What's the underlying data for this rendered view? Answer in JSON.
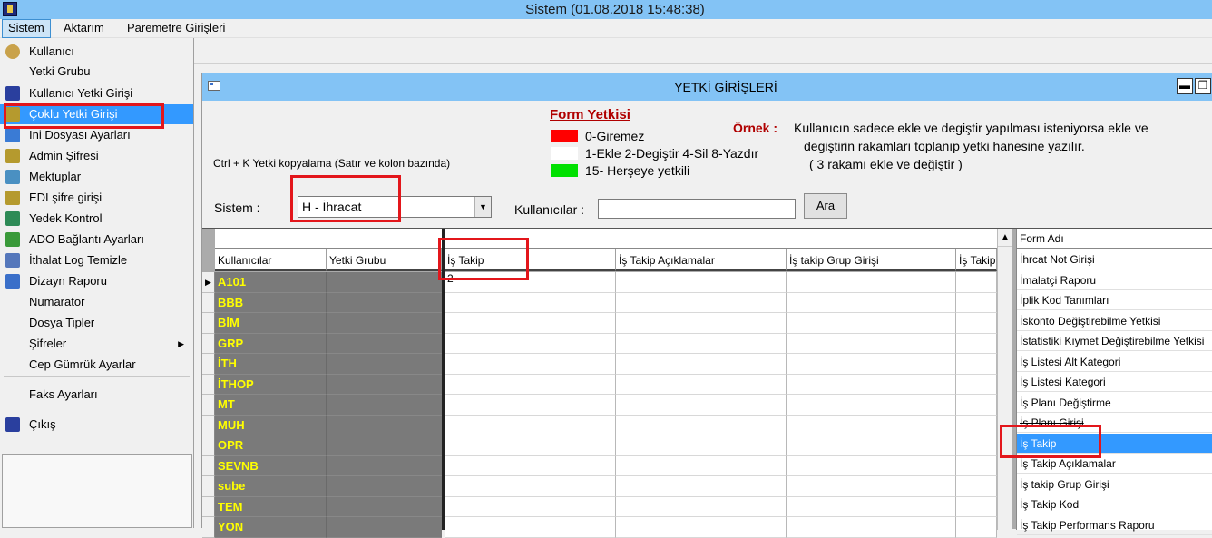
{
  "app": {
    "title": "Sistem (01.08.2018 15:48:38)"
  },
  "menubar": {
    "items": [
      "Sistem",
      "Aktarım",
      "Paremetre Girişleri"
    ]
  },
  "sistem_menu": {
    "items": [
      {
        "label": "Kullanıcı",
        "icon": "user-icon"
      },
      {
        "label": "Yetki Grubu",
        "icon": ""
      },
      {
        "label": "Kullanıcı Yetki Girişi",
        "icon": "book-icon"
      },
      {
        "label": "Çoklu Yetki Girişi",
        "icon": "key-icon",
        "selected": true
      },
      {
        "label": "Ini Dosyası Ayarları",
        "icon": "settings-file-icon"
      },
      {
        "label": "Admin Şifresi",
        "icon": "key-icon"
      },
      {
        "label": "Mektuplar",
        "icon": "mail-icon"
      },
      {
        "label": "EDI şifre girişi",
        "icon": "key-icon"
      },
      {
        "label": "Yedek Kontrol",
        "icon": "backup-icon"
      },
      {
        "label": "ADO Bağlantı Ayarları",
        "icon": "connection-icon"
      },
      {
        "label": "İthalat Log Temizle",
        "icon": "cleanup-icon"
      },
      {
        "label": "Dizayn Raporu",
        "icon": "report-icon"
      },
      {
        "label": "Numarator",
        "icon": ""
      },
      {
        "label": "Dosya Tipler",
        "icon": ""
      },
      {
        "label": "Şifreler",
        "icon": "",
        "submenu": true
      },
      {
        "label": "Cep Gümrük Ayarlar",
        "icon": ""
      },
      {
        "label": "Faks Ayarları",
        "icon": ""
      },
      {
        "label": "Çıkış",
        "icon": "exit-icon"
      }
    ]
  },
  "window": {
    "title": "YETKİ GİRİŞLERİ"
  },
  "legend": {
    "title": "Form Yetkisi",
    "items": [
      {
        "label": "0-Giremez",
        "color": "#ff0000"
      },
      {
        "label": "1-Ekle  2-Degiştir  4-Sil  8-Yazdır",
        "color": "#ffffff"
      },
      {
        "label": "15- Herşeye yetkili",
        "color": "#00e000"
      }
    ],
    "example_label": "Örnek :",
    "description": [
      "Kullanıcın sadece ekle ve degiştir yapılması isteniyorsa  ekle ve",
      "degiştirin rakamları toplanıp yetki hanesine yazılır.",
      "( 3 rakamı ekle ve değiştir )"
    ]
  },
  "note": "Ctrl + K Yetki kopyalama (Satır ve kolon bazında)",
  "filters": {
    "sistem_label": "Sistem :",
    "sistem_value": "H - İhracat",
    "users_label": "Kullanıcılar :",
    "users_value": "",
    "search_button": "Ara"
  },
  "grid": {
    "columns": [
      "Kullanıcılar",
      "Yetki Grubu",
      "İş Takip",
      "İş Takip Açıklamalar",
      "İş takip Grup Girişi",
      "İş Takip"
    ],
    "rows": [
      {
        "user": "A101",
        "is_takip": "2",
        "current": true
      },
      {
        "user": "BBB",
        "is_takip": ""
      },
      {
        "user": "BİM",
        "is_takip": ""
      },
      {
        "user": "GRP",
        "is_takip": ""
      },
      {
        "user": "İTH",
        "is_takip": ""
      },
      {
        "user": "İTHOP",
        "is_takip": ""
      },
      {
        "user": "MT",
        "is_takip": ""
      },
      {
        "user": "MUH",
        "is_takip": ""
      },
      {
        "user": "OPR",
        "is_takip": ""
      },
      {
        "user": "SEVNB",
        "is_takip": ""
      },
      {
        "user": "sube",
        "is_takip": ""
      },
      {
        "user": "TEM",
        "is_takip": ""
      },
      {
        "user": "YON",
        "is_takip": ""
      }
    ]
  },
  "form_list": {
    "header": "Form Adı",
    "items": [
      "İhrcat Not Girişi",
      "İmalatçi Raporu",
      "İplik Kod Tanımları",
      "İskonto Değiştirebilme Yetkisi",
      "İstatistiki Kıymet Değiştirebilme Yetkisi",
      "İş Listesi Alt Kategori",
      "İş Listesi Kategori",
      "İş Planı Değiştirme",
      "İş Planı Girişi",
      "İş Takip",
      "İş Takip Açıklamalar",
      "İş takip Grup Girişi",
      "İş Takip Kod",
      "İş Takip Performans Raporu"
    ],
    "selected_index": 9
  }
}
